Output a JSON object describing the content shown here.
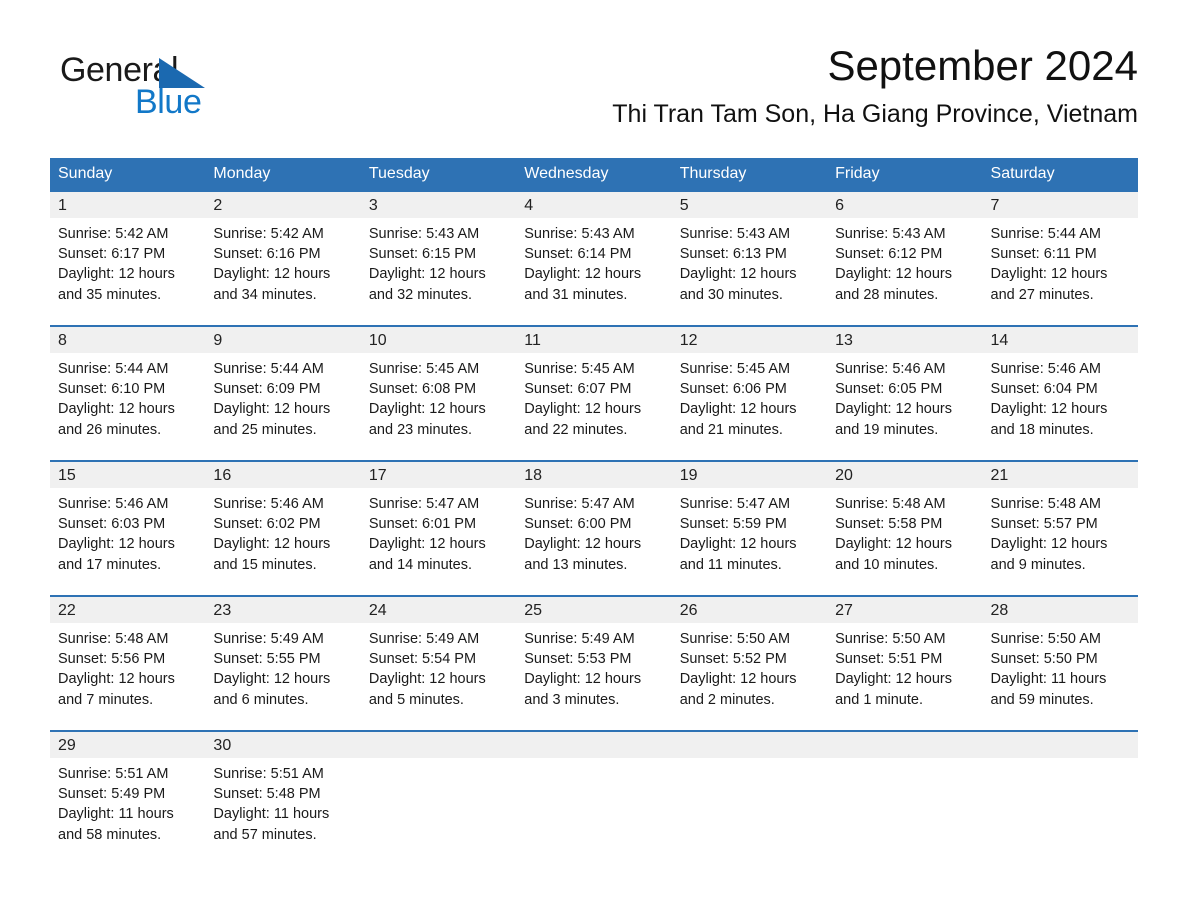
{
  "brand": {
    "line1": "General",
    "line2": "Blue",
    "triangle_color": "#1B69B0",
    "blue_text_color": "#1278C8"
  },
  "header": {
    "month_title": "September 2024",
    "location": "Thi Tran Tam Son, Ha Giang Province, Vietnam"
  },
  "theme": {
    "header_blue": "#2E72B4",
    "day_band_gray": "#F0F0F0",
    "text_color": "#1a1a1a"
  },
  "weekdays": [
    "Sunday",
    "Monday",
    "Tuesday",
    "Wednesday",
    "Thursday",
    "Friday",
    "Saturday"
  ],
  "weeks": [
    [
      {
        "day": "1",
        "sunrise": "Sunrise: 5:42 AM",
        "sunset": "Sunset: 6:17 PM",
        "daylight1": "Daylight: 12 hours",
        "daylight2": "and 35 minutes."
      },
      {
        "day": "2",
        "sunrise": "Sunrise: 5:42 AM",
        "sunset": "Sunset: 6:16 PM",
        "daylight1": "Daylight: 12 hours",
        "daylight2": "and 34 minutes."
      },
      {
        "day": "3",
        "sunrise": "Sunrise: 5:43 AM",
        "sunset": "Sunset: 6:15 PM",
        "daylight1": "Daylight: 12 hours",
        "daylight2": "and 32 minutes."
      },
      {
        "day": "4",
        "sunrise": "Sunrise: 5:43 AM",
        "sunset": "Sunset: 6:14 PM",
        "daylight1": "Daylight: 12 hours",
        "daylight2": "and 31 minutes."
      },
      {
        "day": "5",
        "sunrise": "Sunrise: 5:43 AM",
        "sunset": "Sunset: 6:13 PM",
        "daylight1": "Daylight: 12 hours",
        "daylight2": "and 30 minutes."
      },
      {
        "day": "6",
        "sunrise": "Sunrise: 5:43 AM",
        "sunset": "Sunset: 6:12 PM",
        "daylight1": "Daylight: 12 hours",
        "daylight2": "and 28 minutes."
      },
      {
        "day": "7",
        "sunrise": "Sunrise: 5:44 AM",
        "sunset": "Sunset: 6:11 PM",
        "daylight1": "Daylight: 12 hours",
        "daylight2": "and 27 minutes."
      }
    ],
    [
      {
        "day": "8",
        "sunrise": "Sunrise: 5:44 AM",
        "sunset": "Sunset: 6:10 PM",
        "daylight1": "Daylight: 12 hours",
        "daylight2": "and 26 minutes."
      },
      {
        "day": "9",
        "sunrise": "Sunrise: 5:44 AM",
        "sunset": "Sunset: 6:09 PM",
        "daylight1": "Daylight: 12 hours",
        "daylight2": "and 25 minutes."
      },
      {
        "day": "10",
        "sunrise": "Sunrise: 5:45 AM",
        "sunset": "Sunset: 6:08 PM",
        "daylight1": "Daylight: 12 hours",
        "daylight2": "and 23 minutes."
      },
      {
        "day": "11",
        "sunrise": "Sunrise: 5:45 AM",
        "sunset": "Sunset: 6:07 PM",
        "daylight1": "Daylight: 12 hours",
        "daylight2": "and 22 minutes."
      },
      {
        "day": "12",
        "sunrise": "Sunrise: 5:45 AM",
        "sunset": "Sunset: 6:06 PM",
        "daylight1": "Daylight: 12 hours",
        "daylight2": "and 21 minutes."
      },
      {
        "day": "13",
        "sunrise": "Sunrise: 5:46 AM",
        "sunset": "Sunset: 6:05 PM",
        "daylight1": "Daylight: 12 hours",
        "daylight2": "and 19 minutes."
      },
      {
        "day": "14",
        "sunrise": "Sunrise: 5:46 AM",
        "sunset": "Sunset: 6:04 PM",
        "daylight1": "Daylight: 12 hours",
        "daylight2": "and 18 minutes."
      }
    ],
    [
      {
        "day": "15",
        "sunrise": "Sunrise: 5:46 AM",
        "sunset": "Sunset: 6:03 PM",
        "daylight1": "Daylight: 12 hours",
        "daylight2": "and 17 minutes."
      },
      {
        "day": "16",
        "sunrise": "Sunrise: 5:46 AM",
        "sunset": "Sunset: 6:02 PM",
        "daylight1": "Daylight: 12 hours",
        "daylight2": "and 15 minutes."
      },
      {
        "day": "17",
        "sunrise": "Sunrise: 5:47 AM",
        "sunset": "Sunset: 6:01 PM",
        "daylight1": "Daylight: 12 hours",
        "daylight2": "and 14 minutes."
      },
      {
        "day": "18",
        "sunrise": "Sunrise: 5:47 AM",
        "sunset": "Sunset: 6:00 PM",
        "daylight1": "Daylight: 12 hours",
        "daylight2": "and 13 minutes."
      },
      {
        "day": "19",
        "sunrise": "Sunrise: 5:47 AM",
        "sunset": "Sunset: 5:59 PM",
        "daylight1": "Daylight: 12 hours",
        "daylight2": "and 11 minutes."
      },
      {
        "day": "20",
        "sunrise": "Sunrise: 5:48 AM",
        "sunset": "Sunset: 5:58 PM",
        "daylight1": "Daylight: 12 hours",
        "daylight2": "and 10 minutes."
      },
      {
        "day": "21",
        "sunrise": "Sunrise: 5:48 AM",
        "sunset": "Sunset: 5:57 PM",
        "daylight1": "Daylight: 12 hours",
        "daylight2": "and 9 minutes."
      }
    ],
    [
      {
        "day": "22",
        "sunrise": "Sunrise: 5:48 AM",
        "sunset": "Sunset: 5:56 PM",
        "daylight1": "Daylight: 12 hours",
        "daylight2": "and 7 minutes."
      },
      {
        "day": "23",
        "sunrise": "Sunrise: 5:49 AM",
        "sunset": "Sunset: 5:55 PM",
        "daylight1": "Daylight: 12 hours",
        "daylight2": "and 6 minutes."
      },
      {
        "day": "24",
        "sunrise": "Sunrise: 5:49 AM",
        "sunset": "Sunset: 5:54 PM",
        "daylight1": "Daylight: 12 hours",
        "daylight2": "and 5 minutes."
      },
      {
        "day": "25",
        "sunrise": "Sunrise: 5:49 AM",
        "sunset": "Sunset: 5:53 PM",
        "daylight1": "Daylight: 12 hours",
        "daylight2": "and 3 minutes."
      },
      {
        "day": "26",
        "sunrise": "Sunrise: 5:50 AM",
        "sunset": "Sunset: 5:52 PM",
        "daylight1": "Daylight: 12 hours",
        "daylight2": "and 2 minutes."
      },
      {
        "day": "27",
        "sunrise": "Sunrise: 5:50 AM",
        "sunset": "Sunset: 5:51 PM",
        "daylight1": "Daylight: 12 hours",
        "daylight2": "and 1 minute."
      },
      {
        "day": "28",
        "sunrise": "Sunrise: 5:50 AM",
        "sunset": "Sunset: 5:50 PM",
        "daylight1": "Daylight: 11 hours",
        "daylight2": "and 59 minutes."
      }
    ],
    [
      {
        "day": "29",
        "sunrise": "Sunrise: 5:51 AM",
        "sunset": "Sunset: 5:49 PM",
        "daylight1": "Daylight: 11 hours",
        "daylight2": "and 58 minutes."
      },
      {
        "day": "30",
        "sunrise": "Sunrise: 5:51 AM",
        "sunset": "Sunset: 5:48 PM",
        "daylight1": "Daylight: 11 hours",
        "daylight2": "and 57 minutes."
      },
      {
        "day": "",
        "sunrise": "",
        "sunset": "",
        "daylight1": "",
        "daylight2": ""
      },
      {
        "day": "",
        "sunrise": "",
        "sunset": "",
        "daylight1": "",
        "daylight2": ""
      },
      {
        "day": "",
        "sunrise": "",
        "sunset": "",
        "daylight1": "",
        "daylight2": ""
      },
      {
        "day": "",
        "sunrise": "",
        "sunset": "",
        "daylight1": "",
        "daylight2": ""
      },
      {
        "day": "",
        "sunrise": "",
        "sunset": "",
        "daylight1": "",
        "daylight2": ""
      }
    ]
  ]
}
